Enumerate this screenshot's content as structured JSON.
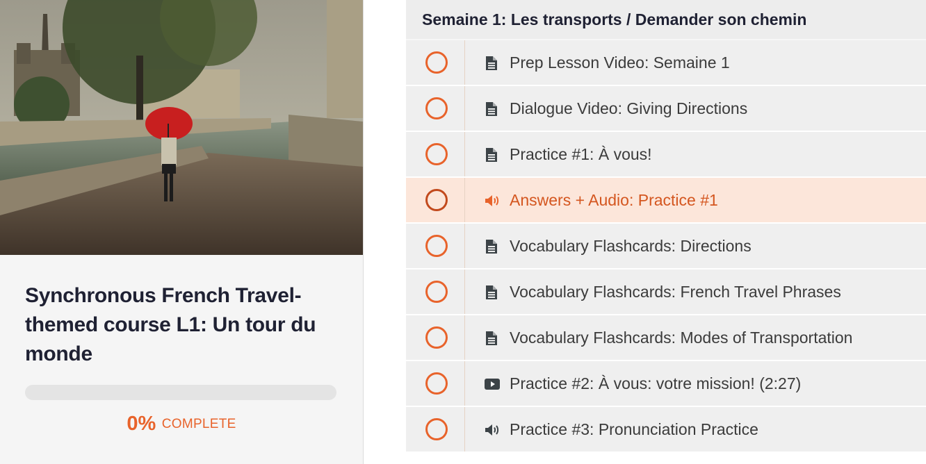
{
  "course": {
    "title": "Synchronous French Travel-themed course L1: Un tour du monde",
    "progress_fraction": 0,
    "progress_percent": "0%",
    "progress_label": "COMPLETE"
  },
  "colors": {
    "accent": "#e8632b",
    "text_dark": "#1f2133",
    "row_bg": "#efefef",
    "active_row_bg": "#fce6da"
  },
  "section": {
    "title": "Semaine 1: Les transports / Demander son chemin"
  },
  "lessons": [
    {
      "title": "Prep Lesson Video: Semaine 1",
      "icon": "document-icon",
      "active": false
    },
    {
      "title": "Dialogue Video: Giving Directions",
      "icon": "document-icon",
      "active": false
    },
    {
      "title": "Practice #1: À vous!",
      "icon": "document-icon",
      "active": false
    },
    {
      "title": "Answers + Audio: Practice #1",
      "icon": "audio-icon",
      "active": true
    },
    {
      "title": "Vocabulary Flashcards: Directions",
      "icon": "document-icon",
      "active": false
    },
    {
      "title": "Vocabulary Flashcards: French Travel Phrases",
      "icon": "document-icon",
      "active": false
    },
    {
      "title": "Vocabulary Flashcards: Modes of Transportation",
      "icon": "document-icon",
      "active": false
    },
    {
      "title": "Practice #2: À vous: votre mission! (2:27)",
      "icon": "video-icon",
      "active": false
    },
    {
      "title": "Practice #3: Pronunciation Practice",
      "icon": "audio-icon",
      "active": false
    }
  ]
}
